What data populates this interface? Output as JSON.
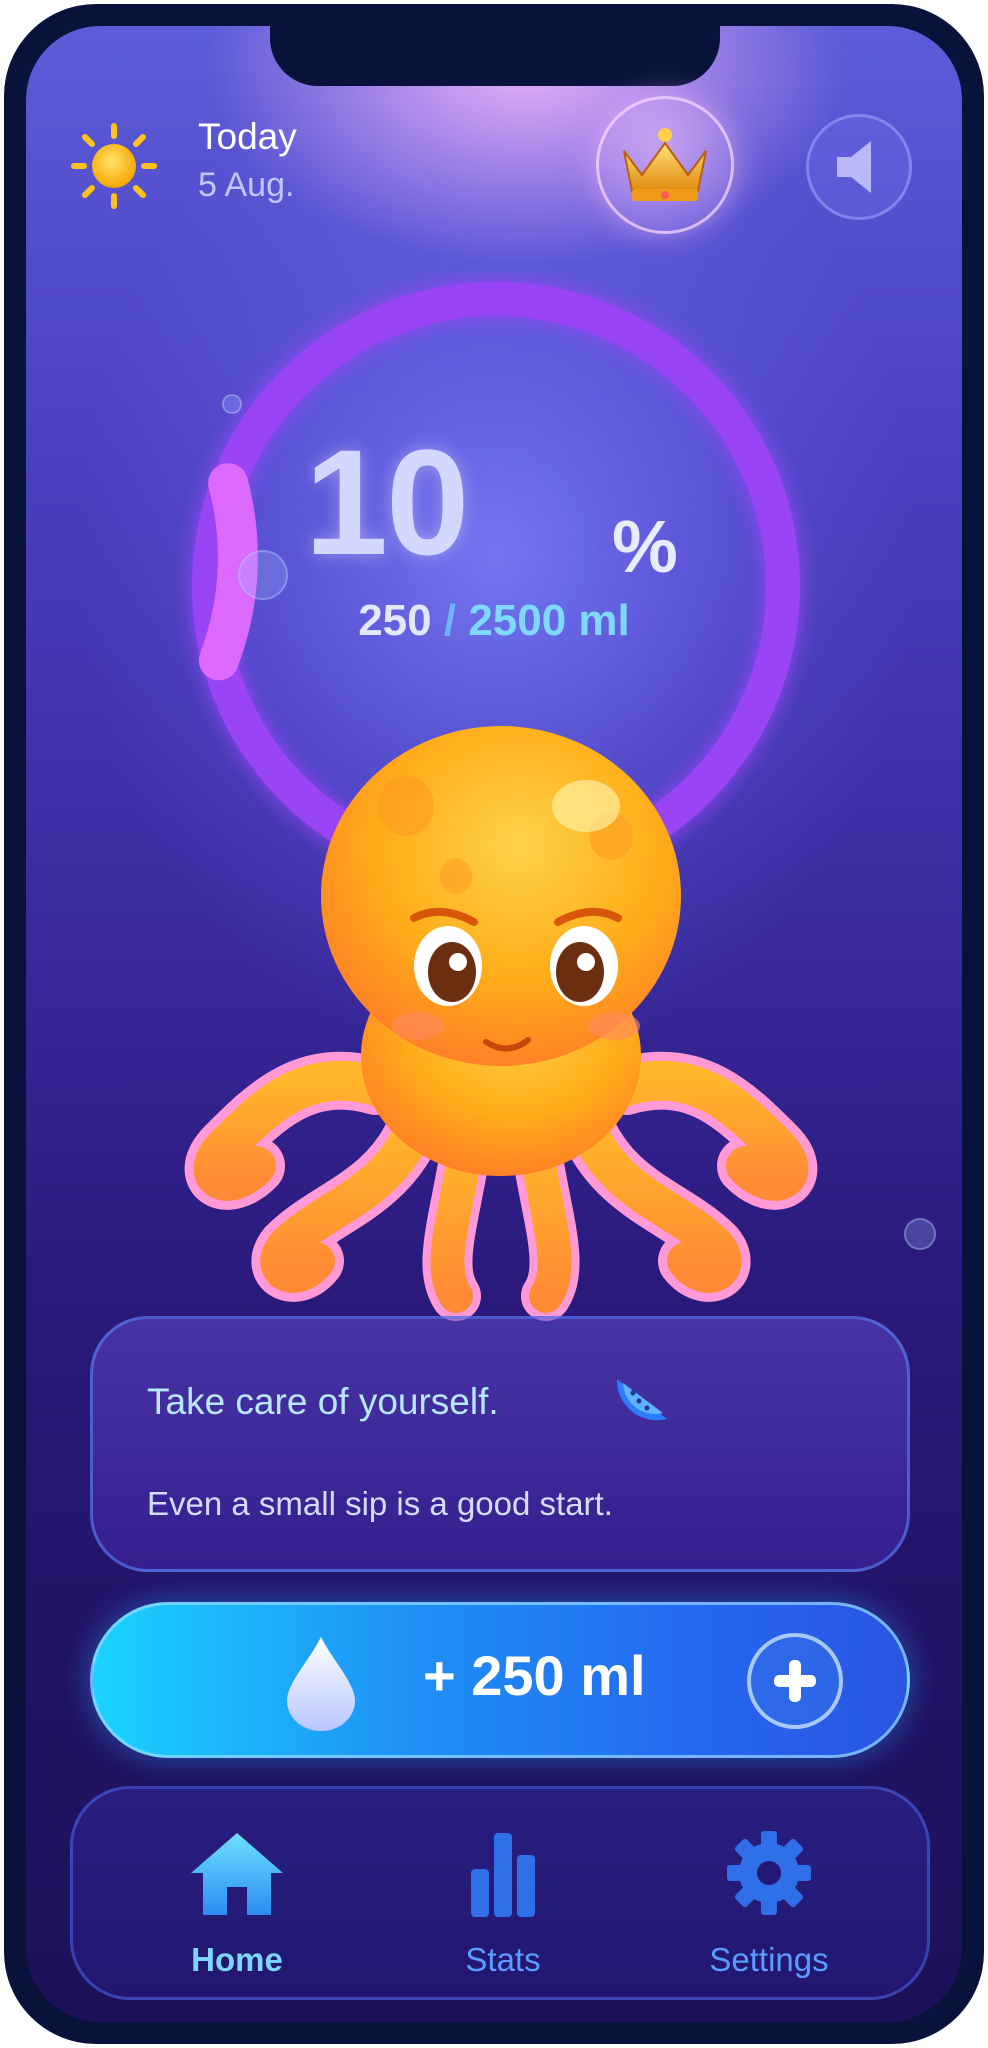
{
  "header": {
    "weather_icon": "sun-icon",
    "day_label": "Today",
    "date_label": "5 Aug.",
    "premium_icon": "crown-icon",
    "sound_icon": "speaker-icon"
  },
  "progress": {
    "percent": "10",
    "percent_sign": "%",
    "consumed": "250",
    "separator": "/",
    "goal": "2500 ml",
    "fraction": 0.1
  },
  "mascot": {
    "name": "octopus-mascot"
  },
  "message": {
    "title": "Take care of yourself.",
    "title_icon": "watermelon-icon",
    "body": "Even a small sip is a good start."
  },
  "add_button": {
    "icon": "water-drop-icon",
    "label": "+ 250 ml",
    "plus_icon": "plus-icon"
  },
  "nav": {
    "items": [
      {
        "label": "Home",
        "icon": "home-icon",
        "active": true
      },
      {
        "label": "Stats",
        "icon": "bar-chart-icon",
        "active": false
      },
      {
        "label": "Settings",
        "icon": "gear-icon",
        "active": false
      }
    ]
  },
  "colors": {
    "accent_ring": "#a64dff",
    "ring_fill": "#e45dff",
    "button_start": "#1ad2ff",
    "button_end": "#2a55e2",
    "active_nav": "#7ed6ff",
    "inactive_nav": "#5a9cff"
  }
}
